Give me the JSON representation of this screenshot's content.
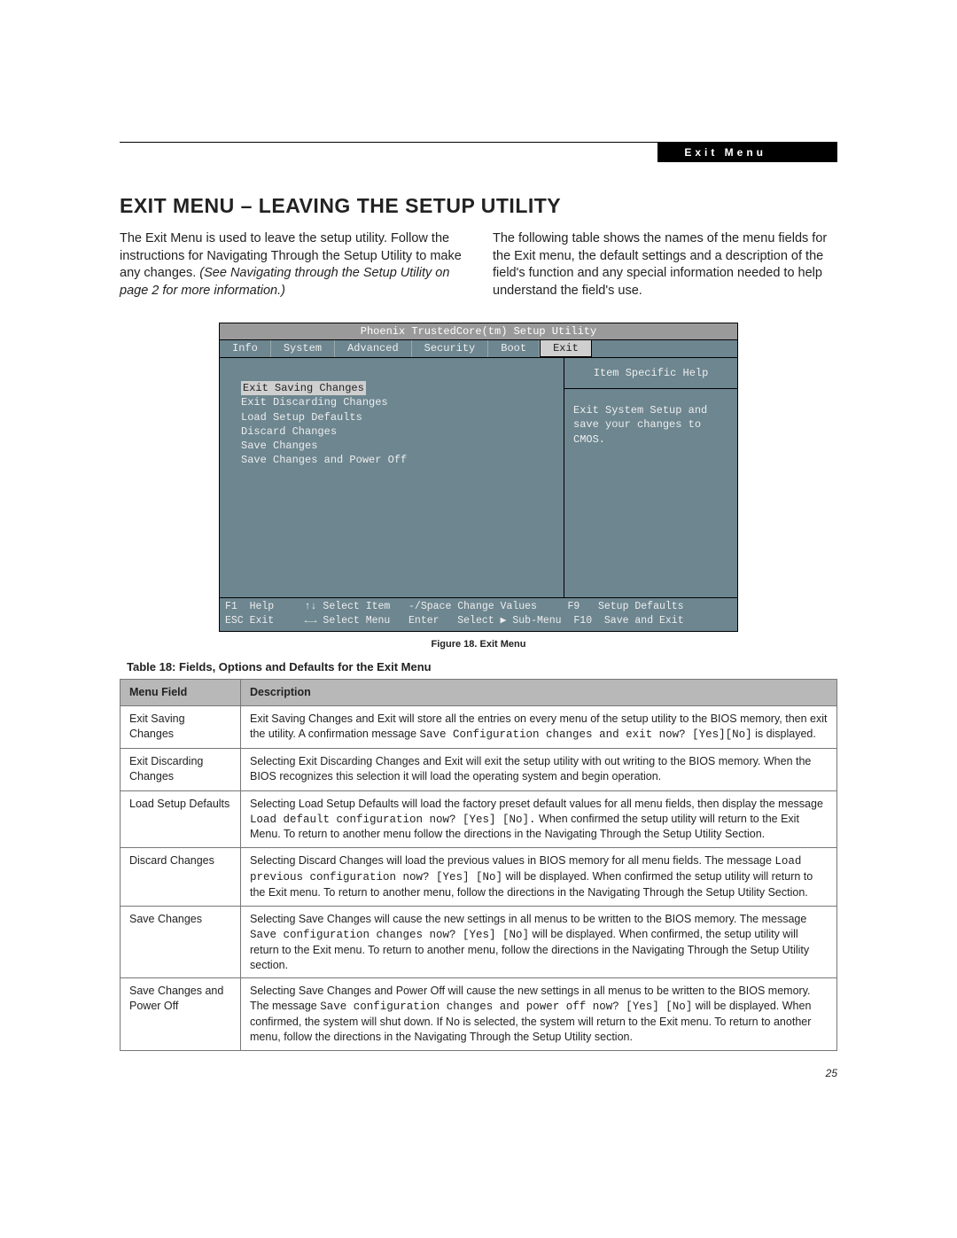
{
  "header": {
    "section_label": "Exit Menu",
    "title": "EXIT MENU – LEAVING THE SETUP UTILITY",
    "left_para_a": "The Exit Menu is used to leave the setup utility. Follow the instructions for Navigating Through the Setup Utility to make any changes. ",
    "left_para_italic": "(See Navigating through the Setup Utility on page 2 for more information.)",
    "right_para": "The following table shows the names of the menu fields for the Exit menu, the default settings and a description of the field's function and any special information needed to help understand the field's use."
  },
  "bios": {
    "title": "Phoenix TrustedCore(tm) Setup Utility",
    "tabs": [
      "Info",
      "System",
      "Advanced",
      "Security",
      "Boot",
      "Exit"
    ],
    "active_tab": "Exit",
    "items": [
      "Exit Saving Changes",
      "Exit Discarding Changes",
      "Load Setup Defaults",
      "Discard Changes",
      "Save Changes",
      "Save Changes and Power Off"
    ],
    "help_title": "Item Specific Help",
    "help_text": "Exit System Setup and save your changes to CMOS.",
    "footer1": "F1  Help     ↑↓ Select Item   -/Space Change Values     F9   Setup Defaults",
    "footer2": "ESC Exit     ←→ Select Menu   Enter   Select ▶ Sub-Menu  F10  Save and Exit"
  },
  "figure_caption": "Figure 18.  Exit Menu",
  "table_caption": "Table 18: Fields, Options and Defaults for the Exit Menu",
  "table": {
    "headers": [
      "Menu Field",
      "Description"
    ],
    "rows": [
      {
        "field": "Exit Saving Changes",
        "desc_a": "Exit Saving Changes and Exit will store all the entries on every menu of the setup utility to the BIOS memory, then exit the utility. A confirmation message ",
        "desc_code": "Save Configuration changes and exit now? [Yes][No]",
        "desc_b": " is displayed."
      },
      {
        "field": "Exit Discarding Changes",
        "desc_a": "Selecting Exit Discarding Changes and Exit will exit the setup utility with out writing to the BIOS memory. When the BIOS recognizes this selection it will load the operating system and begin operation.",
        "desc_code": "",
        "desc_b": ""
      },
      {
        "field": "Load Setup Defaults",
        "desc_a": "Selecting Load Setup Defaults will load the factory preset default values for all menu fields, then display the message ",
        "desc_code": "Load default configuration now? [Yes] [No].",
        "desc_b": " When confirmed the setup utility will return to the Exit Menu. To return to another menu follow the directions in the Navigating Through the Setup Utility Section."
      },
      {
        "field": "Discard Changes",
        "desc_a": "Selecting Discard Changes will load the previous values in BIOS memory for all menu fields. The message ",
        "desc_code": "Load previous configuration now? [Yes] [No]",
        "desc_b": " will be displayed. When confirmed the setup utility will return to the Exit menu. To return to another menu, follow the directions in the Navigating Through the Setup Utility Section."
      },
      {
        "field": "Save Changes",
        "desc_a": "Selecting Save Changes will cause the new settings in all menus to be written to the BIOS memory. The message ",
        "desc_code": "Save configuration changes now? [Yes] [No]",
        "desc_b": " will be displayed. When confirmed, the setup utility will return to the Exit menu. To return to another menu, follow the directions in the Navigating Through the Setup Utility section."
      },
      {
        "field": "Save Changes and Power Off",
        "desc_a": "Selecting Save Changes and Power Off will cause the new settings in all menus to be written to the BIOS memory. The message ",
        "desc_code": "Save configuration changes and power off now? [Yes] [No]",
        "desc_b": " will be displayed. When confirmed, the system will shut down. If No is selected, the system will return to the Exit menu. To return to another menu, follow the directions in the Navigating Through the Setup Utility section."
      }
    ]
  },
  "page_number": "25"
}
